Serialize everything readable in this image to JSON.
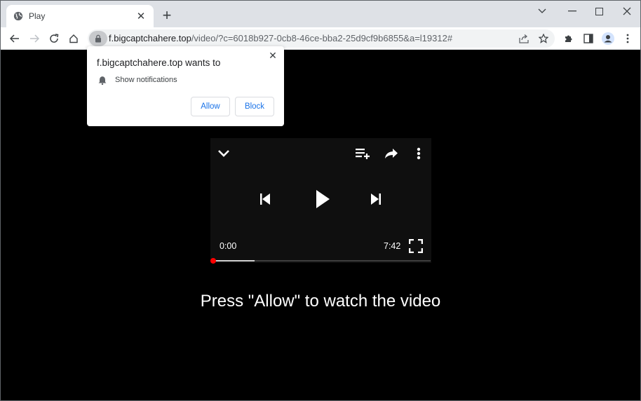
{
  "browser": {
    "tab": {
      "title": "Play",
      "icon": "globe-icon"
    },
    "new_tab_label": "+",
    "window_controls": [
      "tab-search",
      "minimize",
      "maximize",
      "close"
    ],
    "address": {
      "host": "f.bigcaptchahere.top",
      "path": "/video/?c=6018b927-0cb8-46ce-bba2-25d9cf9b6855&a=l19312#"
    }
  },
  "permission_popup": {
    "title": "f.bigcaptchahere.top wants to",
    "permission": "Show notifications",
    "allow_label": "Allow",
    "block_label": "Block"
  },
  "player": {
    "current_time": "0:00",
    "duration": "7:42",
    "played_fraction": 0,
    "buffered_fraction": 0.19,
    "progress_color": "#ff0000"
  },
  "cta_text": "Press \"Allow\" to watch the video"
}
